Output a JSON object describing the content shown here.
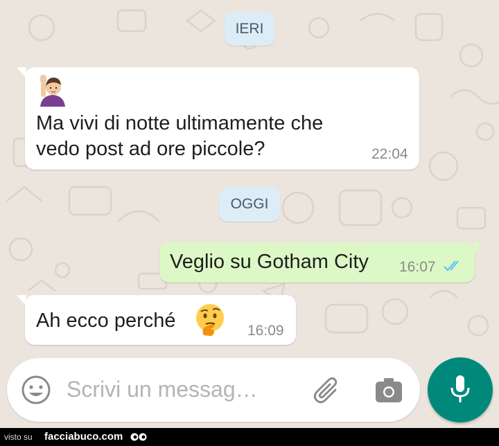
{
  "chat": {
    "date_yesterday": "IERI",
    "date_today": "OGGI",
    "messages": [
      {
        "direction": "incoming",
        "emoji_icon": "person-raising-hand-emoji",
        "line1": "Ma vivi di notte ultimamente che",
        "line2": "vedo post ad ore piccole?",
        "time": "22:04"
      },
      {
        "direction": "outgoing",
        "text": "Veglio su Gotham City",
        "time": "16:07",
        "status_icon": "double-check-read-icon"
      },
      {
        "direction": "incoming",
        "text": "Ah ecco perché",
        "emoji_icon": "thinking-face-emoji",
        "time": "16:09"
      }
    ]
  },
  "composer": {
    "placeholder": "Scrivi un messag…",
    "emoji_icon": "smiley-icon",
    "attach_icon": "paperclip-icon",
    "camera_icon": "camera-icon",
    "mic_icon": "microphone-icon"
  },
  "footer": {
    "prefix": "visto su",
    "site": "facciabuco.com"
  },
  "colors": {
    "background": "#ece5dd",
    "incoming_bubble": "#ffffff",
    "outgoing_bubble": "#dcf8c6",
    "date_pill": "#dcedf7",
    "mic_button": "#00897b",
    "read_ticks": "#4fc3f7"
  }
}
